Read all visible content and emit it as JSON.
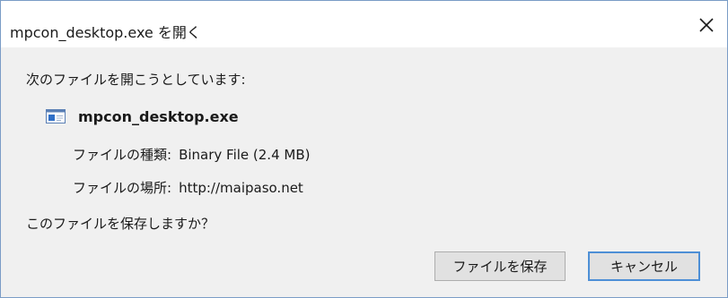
{
  "window": {
    "title": "mpcon_desktop.exe を開く"
  },
  "dialog": {
    "prompt": "次のファイルを開こうとしています:",
    "file_name": "mpcon_desktop.exe",
    "type_label": "ファイルの種類:",
    "type_value": "Binary File (2.4 MB)",
    "from_label": "ファイルの場所:",
    "from_value": "http://maipaso.net",
    "question": "このファイルを保存しますか？"
  },
  "buttons": {
    "save_label": "ファイルを保存",
    "cancel_label": "キャンセル"
  },
  "icons": {
    "close": "close-icon",
    "file": "exe-file-icon"
  },
  "colors": {
    "accent": "#4d8fd6",
    "window_border": "#7a9cc6",
    "dialog_bg": "#f0f0f0",
    "button_bg": "#e1e1e1"
  }
}
